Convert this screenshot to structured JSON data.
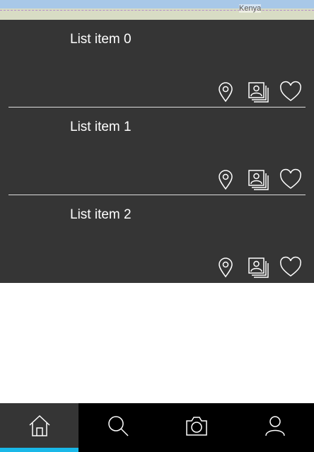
{
  "map": {
    "label": "Kenya"
  },
  "list": {
    "items": [
      {
        "title": "List item 0"
      },
      {
        "title": "List item 1"
      },
      {
        "title": "List item 2"
      }
    ]
  },
  "item_actions": [
    "location-pin-icon",
    "photo-stack-icon",
    "heart-icon"
  ],
  "bottom_nav": {
    "tabs": [
      {
        "icon": "home-icon",
        "active": true
      },
      {
        "icon": "search-icon",
        "active": false
      },
      {
        "icon": "camera-icon",
        "active": false
      },
      {
        "icon": "profile-icon",
        "active": false
      }
    ]
  },
  "colors": {
    "list_bg": "#353535",
    "nav_bg": "#000000",
    "accent": "#19b8e8"
  }
}
